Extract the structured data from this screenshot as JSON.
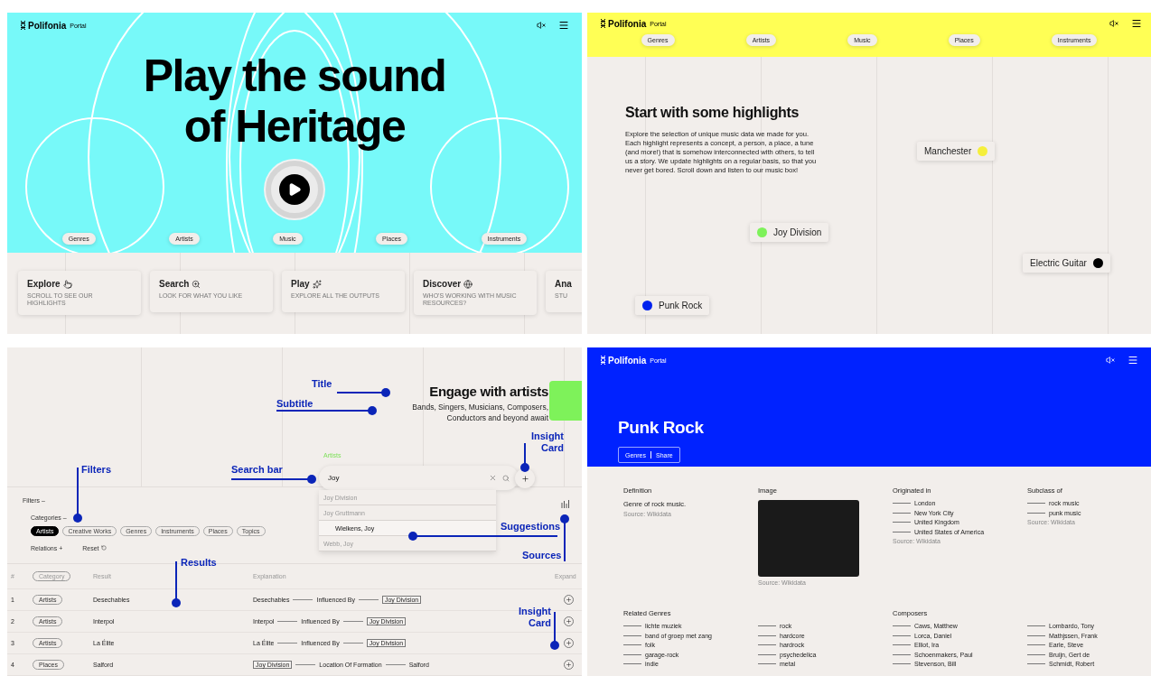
{
  "home": {
    "brand": "Polifonia",
    "brand_sub": "Portal",
    "headline_lines": [
      "Play the sound",
      "of Heritage"
    ],
    "nav": [
      "Genres",
      "Artists",
      "Music",
      "Places",
      "Instruments"
    ],
    "cards": [
      {
        "title": "Explore",
        "subtitle": "SCROLL TO SEE OUR HIGHLIGHTS"
      },
      {
        "title": "Search",
        "subtitle": "LOOK FOR WHAT YOU LIKE"
      },
      {
        "title": "Play",
        "subtitle": "EXPLORE ALL THE OUTPUTS"
      },
      {
        "title": "Discover",
        "subtitle": "WHO'S WORKING WITH MUSIC RESOURCES?"
      },
      {
        "title": "Ana",
        "subtitle": "STU"
      }
    ]
  },
  "highlights": {
    "brand": "Polifonia",
    "brand_sub": "Portal",
    "nav": [
      "Genres",
      "Artists",
      "Music",
      "Places",
      "Instruments"
    ],
    "title": "Start with some highlights",
    "text": "Explore the selection of unique music data we made for you. Each highlight represents a concept, a person, a place, a tune (and more!) that is somehow interconnected with others, to tell us a story. We update highlights on a regular basis, so that you never get bored. Scroll down and listen to our music box!",
    "items": [
      {
        "label": "Manchester",
        "color": "#f5ef3c"
      },
      {
        "label": "Joy Division",
        "color": "#7ef25a"
      },
      {
        "label": "Electric Guitar",
        "color": "#000000"
      },
      {
        "label": "Punk Rock",
        "color": "#0022ee"
      }
    ]
  },
  "search": {
    "title": "Engage with artists",
    "subtitle": "Bands, Singers, Musicians, Composers, Conductors and beyond await",
    "search_label": "Artists",
    "search_value": "Joy",
    "suggestions": [
      {
        "label": "Joy Division",
        "selected": false
      },
      {
        "label": "Joy Gruttmann",
        "selected": false
      },
      {
        "label": "Wielkens, Joy",
        "selected": true
      },
      {
        "label": "Webb, Joy",
        "selected": false
      }
    ],
    "filters_label": "Filters –",
    "categories_label": "Categories –",
    "categories": [
      {
        "label": "Artists",
        "selected": true
      },
      {
        "label": "Creative Works",
        "selected": false
      },
      {
        "label": "Genres",
        "selected": false
      },
      {
        "label": "Instruments",
        "selected": false
      },
      {
        "label": "Places",
        "selected": false
      },
      {
        "label": "Topics",
        "selected": false
      }
    ],
    "relations_label": "Relations +",
    "reset_label": "Reset",
    "columns": [
      "#",
      "Category",
      "Result",
      "Explanation",
      "Expand"
    ],
    "rows": [
      {
        "index": "1",
        "category": "Artists",
        "result": "Desechables",
        "explanation": [
          {
            "text": "Desechables",
            "boxed": false
          },
          {
            "text": "Influenced By",
            "boxed": false
          },
          {
            "text": "Joy Division",
            "boxed": true
          }
        ]
      },
      {
        "index": "2",
        "category": "Artists",
        "result": "Interpol",
        "explanation": [
          {
            "text": "Interpol",
            "boxed": false
          },
          {
            "text": "Influenced By",
            "boxed": false
          },
          {
            "text": "Joy Division",
            "boxed": true
          }
        ]
      },
      {
        "index": "3",
        "category": "Artists",
        "result": "La Élite",
        "explanation": [
          {
            "text": "La Élite",
            "boxed": false
          },
          {
            "text": "Influenced By",
            "boxed": false
          },
          {
            "text": "Joy Division",
            "boxed": true
          }
        ]
      },
      {
        "index": "4",
        "category": "Places",
        "result": "Salford",
        "explanation": [
          {
            "text": "Joy Division",
            "boxed": true
          },
          {
            "text": "Location Of Formation",
            "boxed": false
          },
          {
            "text": "Salford",
            "boxed": false
          }
        ]
      }
    ],
    "annotations": [
      "Title",
      "Subtitle",
      "Insight Card",
      "Filters",
      "Search bar",
      "Suggestions",
      "Sources",
      "Results",
      "Insight Card"
    ]
  },
  "genre_page": {
    "brand": "Polifonia",
    "brand_sub": "Portal",
    "title": "Punk Rock",
    "actions": [
      "Genres",
      "Share"
    ],
    "definition": {
      "heading": "Definition",
      "text": "Genre of rock music.",
      "source": "Source: Wikidata"
    },
    "image": {
      "heading": "Image",
      "source": "Source: Wikidata"
    },
    "originated": {
      "heading": "Originated in",
      "items": [
        "London",
        "New York City",
        "United Kingdom",
        "United States of America"
      ],
      "source": "Source: Wikidata"
    },
    "subclass": {
      "heading": "Subclass of",
      "items": [
        "rock music",
        "punk music"
      ],
      "source": "Source: Wikidata"
    },
    "related": {
      "heading": "Related Genres",
      "columns": [
        [
          "lichte muziek",
          "band of groep met zang",
          "folk",
          "garage-rock",
          "indie"
        ],
        [
          "rock",
          "hardcore",
          "hardrock",
          "psychedelica",
          "metal"
        ]
      ]
    },
    "composers": {
      "heading": "Composers",
      "columns": [
        [
          "Caws, Matthew",
          "Lorca, Daniel",
          "Elliot, Ira",
          "Schoenmakers, Paul",
          "Stevenson, Bill"
        ],
        [
          "Lombardo, Tony",
          "Mathjssen, Frank",
          "Earle, Steve",
          "Bruijn, Gert de",
          "Schmidt, Robert"
        ]
      ]
    }
  }
}
